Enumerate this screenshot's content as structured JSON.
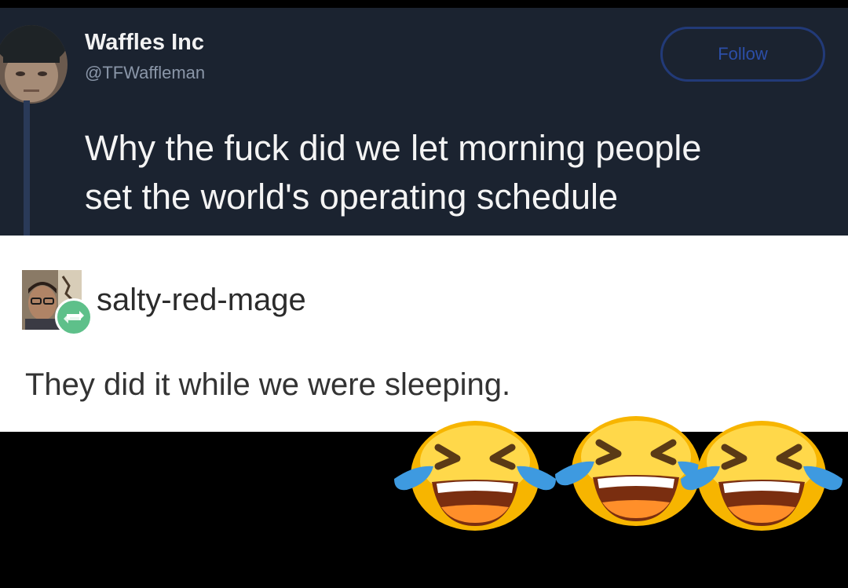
{
  "tweet": {
    "display_name": "Waffles Inc",
    "handle": "@TFWaffleman",
    "follow_label": "Follow",
    "text_line_1": "Why the fuck did we let morning people",
    "text_line_2": "set the world's operating schedule"
  },
  "reply": {
    "username": "salty-red-mage",
    "text": "They did it while we were sleeping."
  },
  "reactions": {
    "emoji_icon": "face-with-tears-of-joy-icon",
    "count": 3
  },
  "colors": {
    "tweet_background": "#1b2330",
    "reply_background": "#ffffff",
    "follow_accent": "#2c4ea8",
    "reblog_badge": "#5ec08a"
  }
}
